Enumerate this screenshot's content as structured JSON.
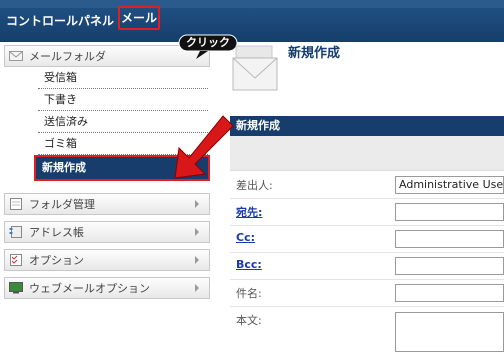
{
  "nav": {
    "control_panel": "コントロールパネル",
    "mail": "メール"
  },
  "callout": {
    "click": "クリック"
  },
  "sidebar": {
    "mail_folder_header": "メールフォルダ",
    "folders": [
      "受信箱",
      "下書き",
      "送信済み",
      "ゴミ箱",
      "新規作成"
    ],
    "sections": [
      "フォルダ管理",
      "アドレス帳",
      "オプション",
      "ウェブメールオプション"
    ]
  },
  "main": {
    "title": "新規作成",
    "section_header": "新規作成",
    "form": {
      "from_label": "差出人:",
      "from_value": "Administrative User",
      "to_label": "宛先:",
      "cc_label": "Cc:",
      "bcc_label": "Bcc:",
      "subject_label": "件名:",
      "body_label": "本文:"
    }
  },
  "colors": {
    "nav_bg": "#153e6b",
    "accent_red": "#e02020",
    "active_bg": "#163d6b"
  }
}
